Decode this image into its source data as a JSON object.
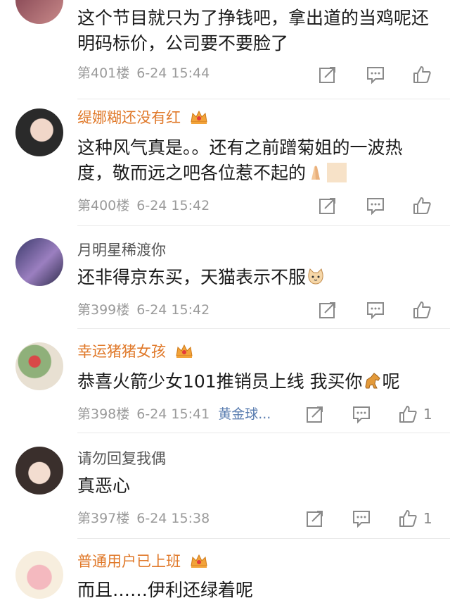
{
  "comments": [
    {
      "username": "",
      "content": "这个节目就只为了挣钱吧，拿出道的当鸡呢还明码标价，公司要不要脸了",
      "floor": "第401楼",
      "time": "6-24 15:44"
    },
    {
      "username": "缇娜糊还没有红",
      "content": "这种风气真是。。还有之前蹭菊姐的一波热度，敬而远之吧各位惹不起的",
      "floor": "第400楼",
      "time": "6-24 15:42"
    },
    {
      "username": "月明星稀渡你",
      "content": "还非得京东买，天猫表示不服",
      "floor": "第399楼",
      "time": "6-24 15:42"
    },
    {
      "username": "幸运猪猪女孩",
      "content_before": "恭喜火箭少女101推销员上线 我买你",
      "content_after": "呢",
      "floor": "第398楼",
      "time": "6-24 15:41",
      "tag": "黄金球...",
      "like_count": "1"
    },
    {
      "username": "请勿回复我偶",
      "content": "真恶心",
      "floor": "第397楼",
      "time": "6-24 15:38",
      "like_count": "1"
    },
    {
      "username": "普通用户已上班",
      "content": "而且……伊利还绿着呢"
    }
  ],
  "icons": {
    "share": "share-icon",
    "comment": "comment-icon",
    "like": "thumbs-up-icon",
    "crown": "vip-crown-icon"
  },
  "colors": {
    "vip_name": "#e0792a",
    "tag": "#5a7db0",
    "meta": "#9a9a9a"
  }
}
